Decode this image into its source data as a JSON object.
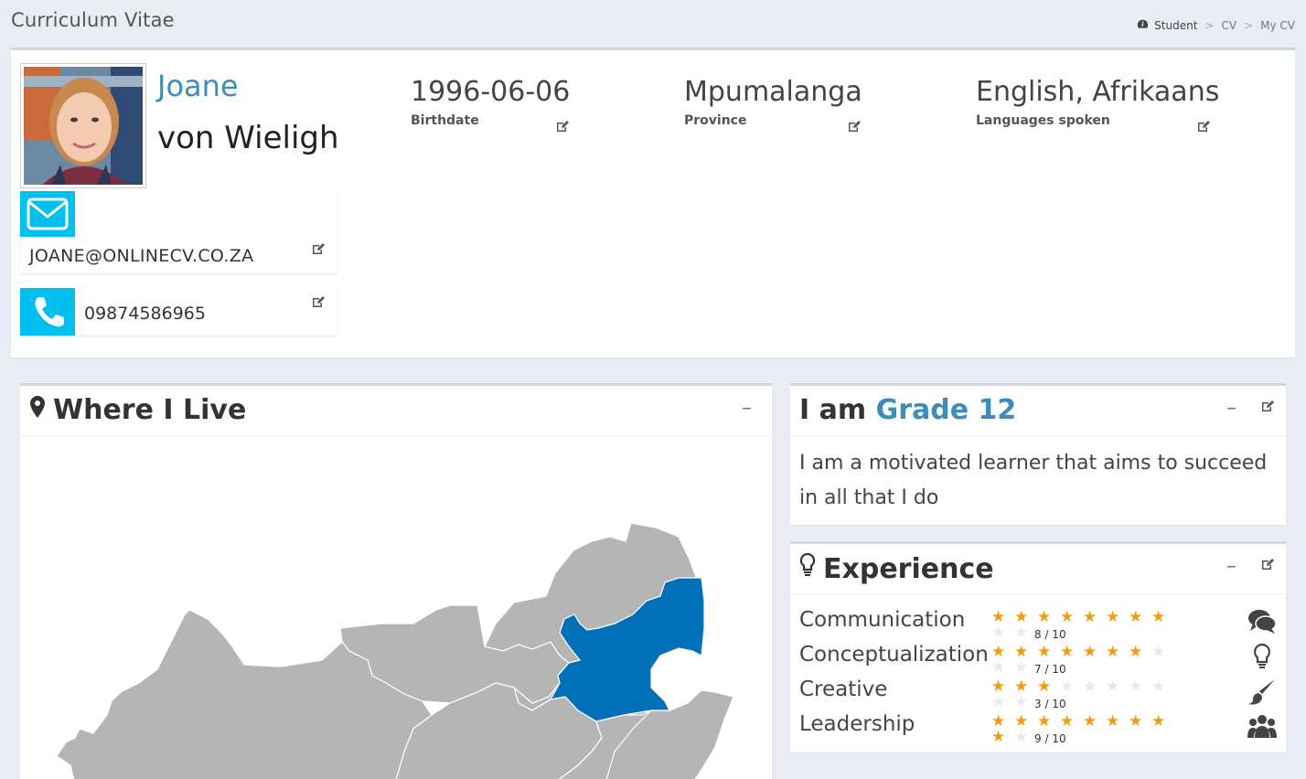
{
  "header": {
    "title": "Curriculum Vitae",
    "breadcrumb": [
      "Student",
      "CV",
      "My CV"
    ],
    "separator": ">"
  },
  "profile": {
    "first_name": "Joane",
    "last_name": "von Wieligh",
    "email": "JOANE@ONLINECV.CO.ZA",
    "phone": "09874586965",
    "birthdate": {
      "value": "1996-06-06",
      "label": "Birthdate"
    },
    "province": {
      "value": "Mpumalanga",
      "label": "Province"
    },
    "languages": {
      "value": "English, Afrikaans",
      "label": "Languages spoken"
    }
  },
  "where_i_live": {
    "title": "Where I Live",
    "collapse_label": "–",
    "highlighted_province": "Mpumalanga"
  },
  "grade": {
    "prefix": "I am",
    "value": "Grade 12",
    "description": "I am a motivated learner that aims to succeed in all that I do",
    "collapse_label": "–"
  },
  "experience": {
    "title": "Experience",
    "collapse_label": "–",
    "max_rating": 10,
    "skills": [
      {
        "name": "Communication",
        "rating": 8,
        "score_label": "8 / 10",
        "icon": "comments-icon"
      },
      {
        "name": "Conceptualization",
        "rating": 7,
        "score_label": "7 / 10",
        "icon": "lightbulb-icon"
      },
      {
        "name": "Creative",
        "rating": 3,
        "score_label": "3 / 10",
        "icon": "paintbrush-icon"
      },
      {
        "name": "Leadership",
        "rating": 9,
        "score_label": "9 / 10",
        "icon": "users-icon"
      }
    ]
  },
  "colors": {
    "accent": "#3c8dbc",
    "info_box": "#00c0ef",
    "star_on": "#f39c12",
    "star_off": "#e6e9ee",
    "map_region": "#b5b5b5",
    "map_highlight": "#0071b9",
    "background": "#e9ecf3"
  }
}
